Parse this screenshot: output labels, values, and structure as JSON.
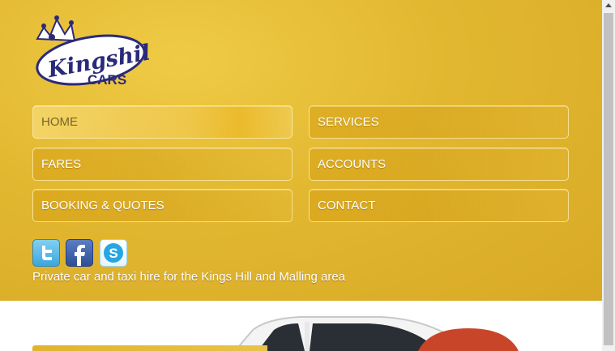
{
  "logo": {
    "text_top": "Kingshill",
    "text_bottom": "CARS"
  },
  "nav": [
    {
      "label": "HOME"
    },
    {
      "label": "SERVICES"
    },
    {
      "label": "FARES"
    },
    {
      "label": "ACCOUNTS"
    },
    {
      "label": "BOOKING & QUOTES"
    },
    {
      "label": "CONTACT"
    }
  ],
  "social": [
    {
      "icon": "twitter-icon"
    },
    {
      "icon": "facebook-icon"
    },
    {
      "icon": "skype-icon"
    }
  ],
  "tagline": "Private car and taxi hire for the Kings Hill and Malling area",
  "colors": {
    "header_gold": "#e2b730",
    "logo_navy": "#2b2a7a",
    "twitter": "#4fb6e6",
    "facebook": "#3b5ba0",
    "skype": "#27a6e3",
    "brake_orange": "#c8452a"
  }
}
